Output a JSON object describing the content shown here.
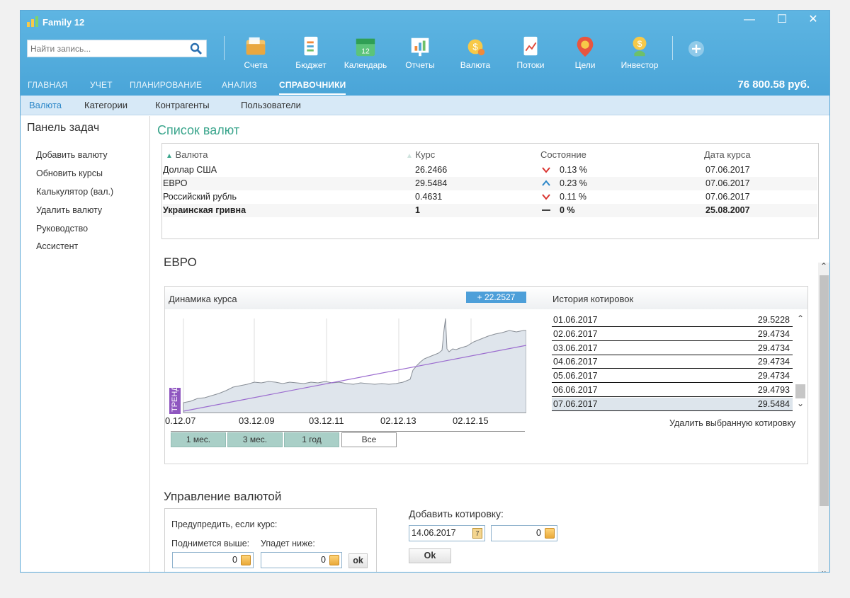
{
  "app": {
    "title": "Family 12"
  },
  "window_controls": {
    "minimize": "—",
    "maximize": "☐",
    "close": "✕"
  },
  "search": {
    "placeholder": "Найти запись..."
  },
  "toolbar": [
    {
      "id": "accounts",
      "label": "Счета",
      "icon": "wallet-icon"
    },
    {
      "id": "budget",
      "label": "Бюджет",
      "icon": "budget-icon"
    },
    {
      "id": "calendar",
      "label": "Календарь",
      "icon": "calendar-icon",
      "day": "12"
    },
    {
      "id": "reports",
      "label": "Отчеты",
      "icon": "reports-icon"
    },
    {
      "id": "currency",
      "label": "Валюта",
      "icon": "currency-icon"
    },
    {
      "id": "flows",
      "label": "Потоки",
      "icon": "flows-icon"
    },
    {
      "id": "goals",
      "label": "Цели",
      "icon": "goals-icon"
    },
    {
      "id": "investor",
      "label": "Инвестор",
      "icon": "investor-icon"
    }
  ],
  "main_nav": [
    "ГЛАВНАЯ",
    "УЧЕТ",
    "ПЛАНИРОВАНИЕ",
    "АНАЛИЗ",
    "СПРАВОЧНИКИ"
  ],
  "main_nav_active": "СПРАВОЧНИКИ",
  "balance": "76 800.58 руб.",
  "sub_nav": [
    "Валюта",
    "Категории",
    "Контрагенты",
    "Пользователи"
  ],
  "sub_nav_active": "Валюта",
  "sidebar": {
    "title": "Панель задач",
    "items": [
      "Добавить валюту",
      "Обновить курсы",
      "Калькулятор (вал.)",
      "Удалить валюту",
      "Руководство",
      "Ассистент"
    ]
  },
  "currency_list": {
    "title": "Список валют",
    "columns": [
      "Валюта",
      "Курс",
      "Состояние",
      "Дата курса"
    ],
    "rows": [
      {
        "name": "Доллар США",
        "rate": "26.2466",
        "trend": "down",
        "state": "0.13 %",
        "date": "07.06.2017",
        "bold": false
      },
      {
        "name": "ЕВРО",
        "rate": "29.5484",
        "trend": "up",
        "state": "0.23 %",
        "date": "07.06.2017",
        "bold": false
      },
      {
        "name": "Российский рубль",
        "rate": "0.4631",
        "trend": "down",
        "state": "0.11 %",
        "date": "07.06.2017",
        "bold": false
      },
      {
        "name": "Украинская гривна",
        "rate": "1",
        "trend": "flat",
        "state": "0 %",
        "date": "25.08.2007",
        "bold": true
      }
    ],
    "colors": {
      "down": "#d9322e",
      "up": "#2a86c8",
      "flat": "#444444"
    }
  },
  "detail": {
    "currency": "ЕВРО",
    "dynamics_label": "Динамика курса",
    "delta": "+ 22.2527",
    "trend_label": "ТРЕНД",
    "history_label": "История котировок",
    "x_ticks": [
      "0.12.07",
      "03.12.09",
      "03.12.11",
      "02.12.13",
      "02.12.15"
    ],
    "range_buttons": [
      "1 мес.",
      "3 мес.",
      "1 год",
      "Все"
    ],
    "range_selected": "Все",
    "history": [
      {
        "date": "01.06.2017",
        "value": "29.5228"
      },
      {
        "date": "02.06.2017",
        "value": "29.4734"
      },
      {
        "date": "03.06.2017",
        "value": "29.4734"
      },
      {
        "date": "04.06.2017",
        "value": "29.4734"
      },
      {
        "date": "05.06.2017",
        "value": "29.4734"
      },
      {
        "date": "06.06.2017",
        "value": "29.4793"
      },
      {
        "date": "07.06.2017",
        "value": "29.5484"
      }
    ],
    "history_selected": "07.06.2017",
    "delete_quote": "Удалить выбранную котировку"
  },
  "management": {
    "title": "Управление валютой",
    "alert_label": "Предупредить, если курс:",
    "rise_label": "Поднимется выше:",
    "fall_label": "Упадет ниже:",
    "rise_value": "0",
    "fall_value": "0",
    "ok": "ok",
    "add_quote_label": "Добавить котировку:",
    "quote_date": "14.06.2017",
    "quote_value": "0",
    "add_ok": "Ok",
    "calendar_day": "7"
  },
  "chart_colors": {
    "fill": "#dfe5ec",
    "line": "#888e96",
    "trend": "#9b6ccf",
    "grid": "#dcdcdc",
    "badge": "#4d9fd9"
  }
}
